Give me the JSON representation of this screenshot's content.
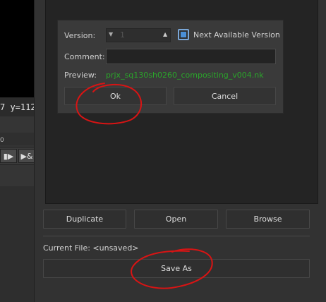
{
  "background_app": {
    "coords_text": "7 y=112",
    "timeline_tick": "0",
    "controls": [
      "▮▶",
      "▶&"
    ]
  },
  "version_dialog": {
    "version_label": "Version:",
    "version_value": "1",
    "next_version_label": "Next Available Version",
    "next_version_checked": true,
    "comment_label": "Comment:",
    "comment_value": "",
    "preview_label": "Preview:",
    "preview_value": "prjx_sq130sh0260_compositing_v004.nk",
    "ok_label": "Ok",
    "cancel_label": "Cancel"
  },
  "main_dialog": {
    "duplicate_label": "Duplicate",
    "open_label": "Open",
    "browse_label": "Browse",
    "current_file_text": "Current File: <unsaved>",
    "save_as_label": "Save As"
  },
  "colors": {
    "annotation": "#d81414",
    "preview_text": "#2aa52a",
    "checkbox_accent": "#4a8fd6"
  },
  "icons": {
    "spinner_down": "down-arrow-icon",
    "spinner_up": "up-arrow-icon"
  }
}
